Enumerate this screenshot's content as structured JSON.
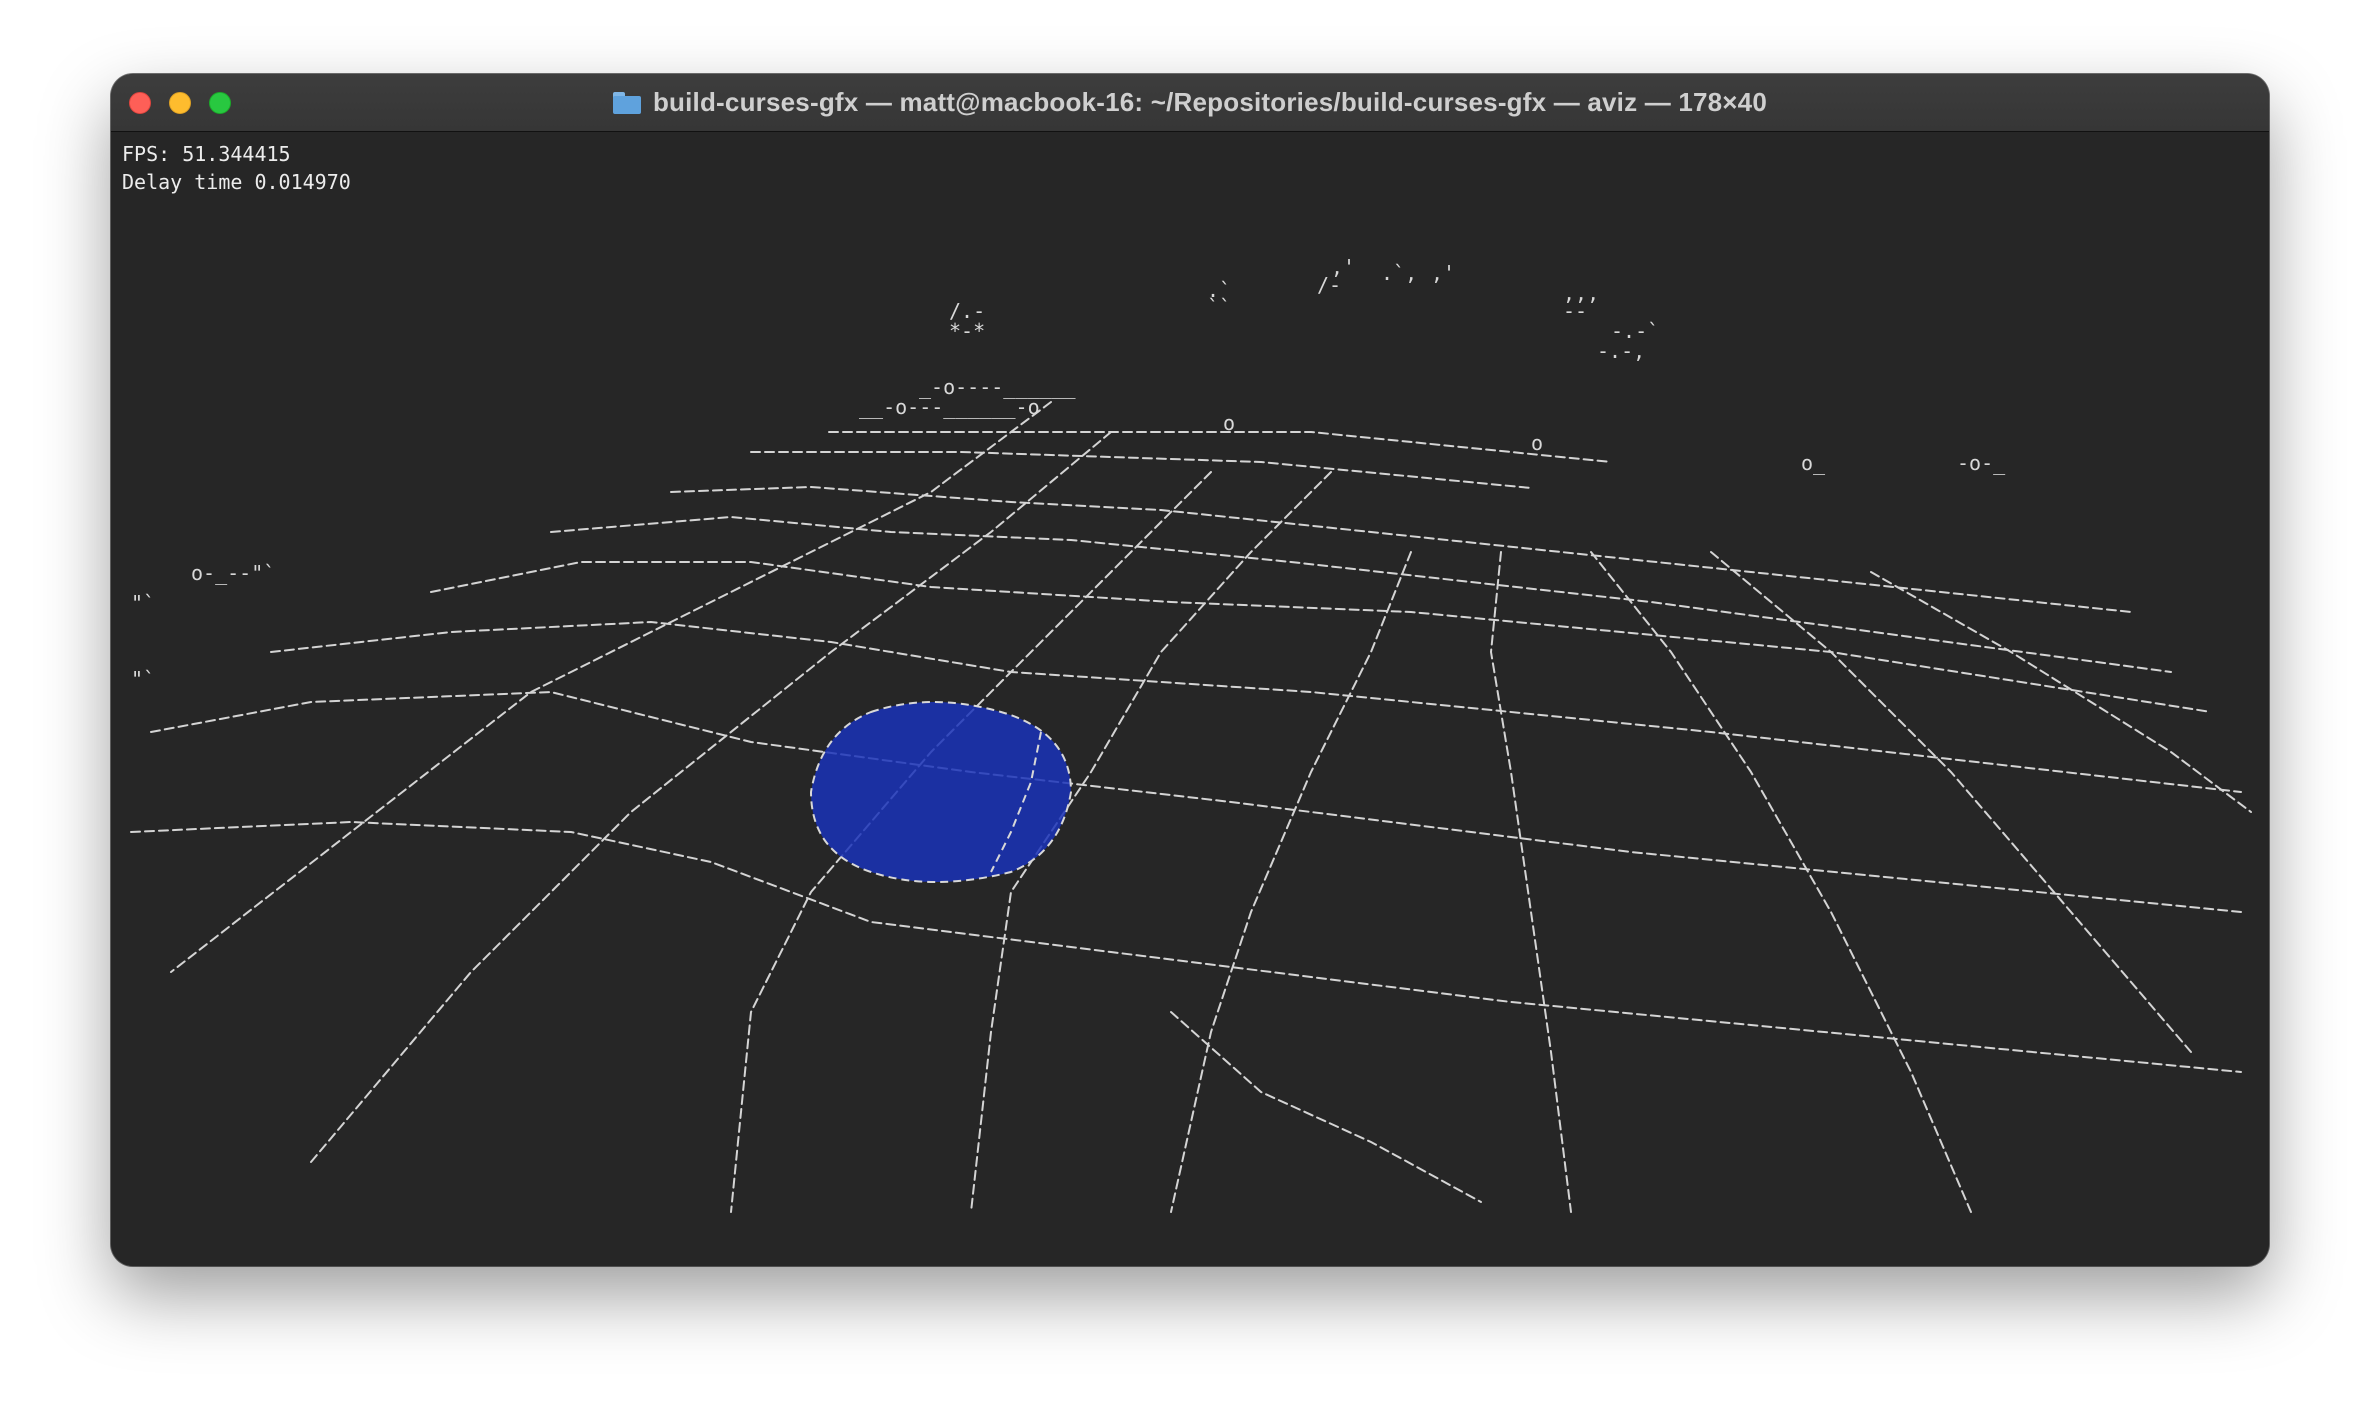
{
  "window": {
    "title": "build-curses-gfx — matt@macbook-16: ~/Repositories/build-curses-gfx — aviz — 178×40",
    "folder_icon": "folder-icon",
    "colors": {
      "background": "#262626",
      "text": "#ececec",
      "ascii": "#d9d9d9",
      "blob": "#1a32b8"
    }
  },
  "terminal": {
    "fps": "FPS: 51.344415",
    "delay": "Delay time 0.014970"
  }
}
